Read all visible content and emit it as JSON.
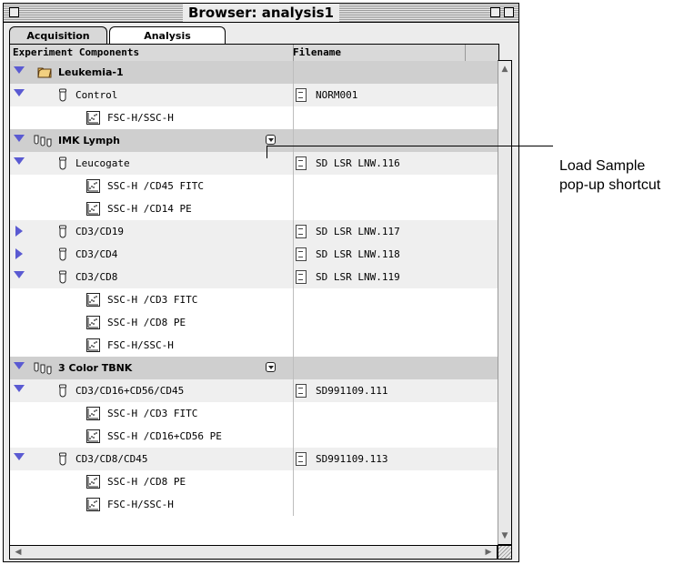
{
  "window": {
    "title": "Browser: analysis1"
  },
  "tabs": [
    {
      "label": "Acquisition"
    },
    {
      "label": "Analysis"
    }
  ],
  "columns": {
    "components": "Experiment Components",
    "filename": "Filename"
  },
  "rows": [
    {
      "kind": "group",
      "indent": 0,
      "expanded": true,
      "icon": "folder-icon",
      "label": "Leukemia-1",
      "filename": "",
      "popup": false
    },
    {
      "kind": "tube",
      "indent": 1,
      "expanded": true,
      "icon": "tube-icon",
      "label": "Control",
      "filename": "NORM001",
      "popup": false
    },
    {
      "kind": "plot",
      "indent": 2,
      "icon": "plot-icon",
      "label": "FSC-H/SSC-H",
      "filename": ""
    },
    {
      "kind": "group",
      "indent": 0,
      "expanded": true,
      "icon": "tubes-icon",
      "label": "IMK Lymph",
      "filename": "",
      "popup": true
    },
    {
      "kind": "tube",
      "indent": 1,
      "expanded": true,
      "icon": "tube-icon",
      "label": "Leucogate",
      "filename": "SD LSR LNW.116",
      "popup": false
    },
    {
      "kind": "plot",
      "indent": 2,
      "icon": "plot-icon",
      "label": "SSC-H /CD45 FITC",
      "filename": ""
    },
    {
      "kind": "plot",
      "indent": 2,
      "icon": "plot-icon",
      "label": "SSC-H /CD14 PE",
      "filename": ""
    },
    {
      "kind": "tube",
      "indent": 1,
      "expanded": false,
      "icon": "tube-icon",
      "label": "CD3/CD19",
      "filename": "SD LSR LNW.117",
      "popup": false
    },
    {
      "kind": "tube",
      "indent": 1,
      "expanded": false,
      "icon": "tube-icon",
      "label": "CD3/CD4",
      "filename": "SD LSR LNW.118",
      "popup": false
    },
    {
      "kind": "tube",
      "indent": 1,
      "expanded": true,
      "icon": "tube-icon",
      "label": "CD3/CD8",
      "filename": "SD LSR LNW.119",
      "popup": false
    },
    {
      "kind": "plot",
      "indent": 2,
      "icon": "plot-icon",
      "label": "SSC-H /CD3 FITC",
      "filename": ""
    },
    {
      "kind": "plot",
      "indent": 2,
      "icon": "plot-icon",
      "label": "SSC-H /CD8 PE",
      "filename": ""
    },
    {
      "kind": "plot",
      "indent": 2,
      "icon": "plot-icon",
      "label": "FSC-H/SSC-H",
      "filename": ""
    },
    {
      "kind": "group",
      "indent": 0,
      "expanded": true,
      "icon": "tubes-icon",
      "label": "3 Color TBNK",
      "filename": "",
      "popup": true
    },
    {
      "kind": "tube",
      "indent": 1,
      "expanded": true,
      "icon": "tube-icon",
      "label": "CD3/CD16+CD56/CD45",
      "filename": "SD991109.111",
      "popup": false
    },
    {
      "kind": "plot",
      "indent": 2,
      "icon": "plot-icon",
      "label": "SSC-H /CD3 FITC",
      "filename": ""
    },
    {
      "kind": "plot",
      "indent": 2,
      "icon": "plot-icon",
      "label": "SSC-H /CD16+CD56 PE",
      "filename": ""
    },
    {
      "kind": "tube",
      "indent": 1,
      "expanded": true,
      "icon": "tube-icon",
      "label": "CD3/CD8/CD45",
      "filename": "SD991109.113",
      "popup": false
    },
    {
      "kind": "plot",
      "indent": 2,
      "icon": "plot-icon",
      "label": "SSC-H /CD8 PE",
      "filename": ""
    },
    {
      "kind": "plot",
      "indent": 2,
      "icon": "plot-icon",
      "label": "FSC-H/SSC-H",
      "filename": ""
    }
  ],
  "callout": {
    "line1": "Load Sample",
    "line2": "pop-up shortcut"
  },
  "colors": {
    "disclosure": "#5a5ad2",
    "group_row": "#cfcfcf",
    "tube_row": "#efefef"
  }
}
